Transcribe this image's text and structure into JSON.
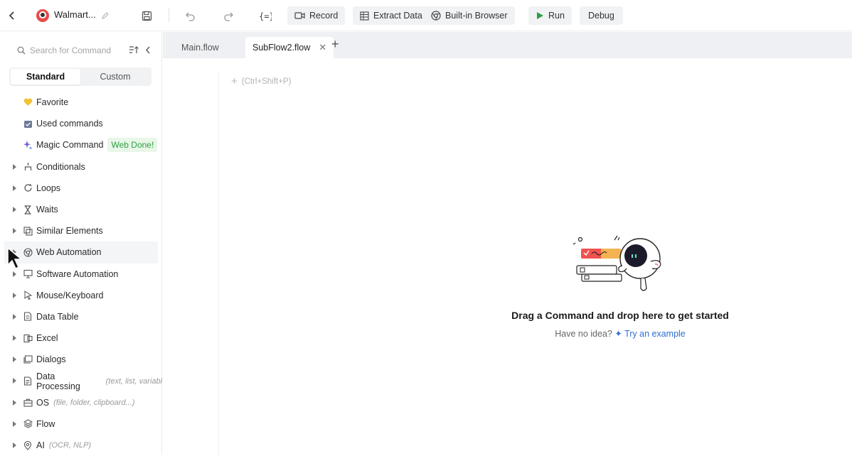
{
  "toolbar": {
    "app_title": "Walmart...",
    "record_label": "Record",
    "extract_label": "Extract Data",
    "browser_label": "Built-in Browser",
    "run_label": "Run",
    "debug_label": "Debug",
    "run_color": "#2f9e44"
  },
  "sidebar": {
    "search_placeholder": "Search for Command",
    "tabs": {
      "standard": "Standard",
      "custom": "Custom"
    },
    "items": [
      {
        "label": "Favorite",
        "icon": "heart-icon"
      },
      {
        "label": "Used commands",
        "icon": "calendar-icon"
      },
      {
        "label": "Magic Command",
        "icon": "sparkle-icon",
        "badge": "Web Done!"
      },
      {
        "label": "Conditionals",
        "icon": "branch-icon"
      },
      {
        "label": "Loops",
        "icon": "loop-icon"
      },
      {
        "label": "Waits",
        "icon": "hourglass-icon"
      },
      {
        "label": "Similar Elements",
        "icon": "similar-icon"
      },
      {
        "label": "Web Automation",
        "icon": "chrome-icon"
      },
      {
        "label": "Software Automation",
        "icon": "monitor-icon"
      },
      {
        "label": "Mouse/Keyboard",
        "icon": "pointer-icon"
      },
      {
        "label": "Data Table",
        "icon": "table-icon"
      },
      {
        "label": "Excel",
        "icon": "excel-icon"
      },
      {
        "label": "Dialogs",
        "icon": "dialog-icon"
      },
      {
        "label": "Data Processing",
        "icon": "data-icon",
        "hint": "(text, list, variabl"
      },
      {
        "label": "OS",
        "icon": "briefcase-icon",
        "hint": "(file, folder, clipboard...)"
      },
      {
        "label": "Flow",
        "icon": "layers-icon"
      },
      {
        "label": "AI",
        "icon": "pin-icon",
        "hint": "(OCR, NLP)"
      }
    ]
  },
  "tabs": {
    "main": "Main.flow",
    "sub": "SubFlow2.flow"
  },
  "canvas": {
    "add_hint": "(Ctrl+Shift+P)",
    "empty_title": "Drag a Command and drop here to get started",
    "empty_sub": "Have no idea?",
    "empty_link": "Try an example"
  }
}
